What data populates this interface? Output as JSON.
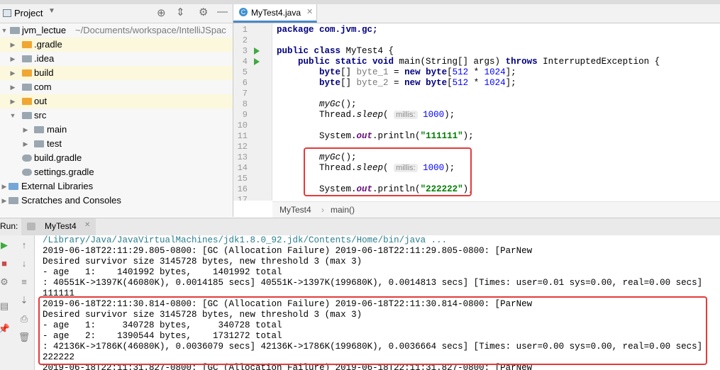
{
  "project_panel": {
    "title": "Project",
    "root": {
      "name": "jvm_lectue",
      "path": "~/Documents/workspace/IntelliJSpac"
    },
    "items": [
      {
        "label": ".gradle"
      },
      {
        "label": ".idea"
      },
      {
        "label": "build"
      },
      {
        "label": "com"
      },
      {
        "label": "out"
      },
      {
        "label": "src"
      },
      {
        "label": "main"
      },
      {
        "label": "test"
      },
      {
        "label": "build.gradle"
      },
      {
        "label": "settings.gradle"
      },
      {
        "label": "External Libraries"
      },
      {
        "label": "Scratches and Consoles"
      }
    ]
  },
  "editor": {
    "tab_label": "MyTest4.java",
    "line_numbers": [
      "1",
      "2",
      "3",
      "4",
      "5",
      "6",
      "7",
      "8",
      "9",
      "10",
      "11",
      "12",
      "13",
      "14",
      "15",
      "16",
      "17"
    ],
    "code": {
      "l1": "package com.jvm.gc;",
      "l3a": "public class",
      "l3b": " MyTest4 {",
      "l4a": "    public static void",
      "l4b": " main(String[] args) ",
      "l4c": "throws",
      "l4d": " InterruptedException {",
      "l5a": "        byte",
      "l5b": "[] ",
      "l5c": "byte_1",
      "l5d": " = ",
      "l5e": "new byte",
      "l5f": "[",
      "l5g": "512",
      "l5h": " * ",
      "l5i": "1024",
      "l5j": "];",
      "l6c": "byte_2",
      "l6g": "512",
      "l6i": "1024",
      "l8": "myGc",
      "l8b": "();",
      "l9a": "        Thread.",
      "l9b": "sleep",
      "l9c": "(",
      "hint": "millis:",
      "l9d": "1000",
      "l9e": ");",
      "l11a": "        System.",
      "l11b": "out",
      "l11c": ".println(",
      "l11d": "\"111111\"",
      "l11e": ");",
      "l16d": "\"222222\""
    },
    "breadcrumb": [
      "MyTest4",
      "main()"
    ]
  },
  "run_panel": {
    "label": "Run:",
    "tab_label": "MyTest4",
    "console_lines": [
      "/Library/Java/JavaVirtualMachines/jdk1.8.0_92.jdk/Contents/Home/bin/java ...",
      "2019-06-18T22:11:29.805-0800: [GC (Allocation Failure) 2019-06-18T22:11:29.805-0800: [ParNew",
      "Desired survivor size 3145728 bytes, new threshold 3 (max 3)",
      "- age   1:    1401992 bytes,    1401992 total",
      ": 40551K->1397K(46080K), 0.0014185 secs] 40551K->1397K(199680K), 0.0014813 secs] [Times: user=0.01 sys=0.00, real=0.00 secs]",
      "111111",
      "2019-06-18T22:11:30.814-0800: [GC (Allocation Failure) 2019-06-18T22:11:30.814-0800: [ParNew",
      "Desired survivor size 3145728 bytes, new threshold 3 (max 3)",
      "- age   1:     340728 bytes,     340728 total",
      "- age   2:    1390544 bytes,    1731272 total",
      ": 42136K->1786K(46080K), 0.0036079 secs] 42136K->1786K(199680K), 0.0036664 secs] [Times: user=0.00 sys=0.00, real=0.00 secs]",
      "222222",
      "2019-06-18T22:11:31.827-0800: [GC (Allocation Failure) 2019-06-18T22:11:31.827-0800: [ParNew"
    ]
  },
  "colors": {
    "accent": "#4a88c7",
    "highlight_box": "#e53a3a",
    "run_green": "#3fa93f"
  }
}
